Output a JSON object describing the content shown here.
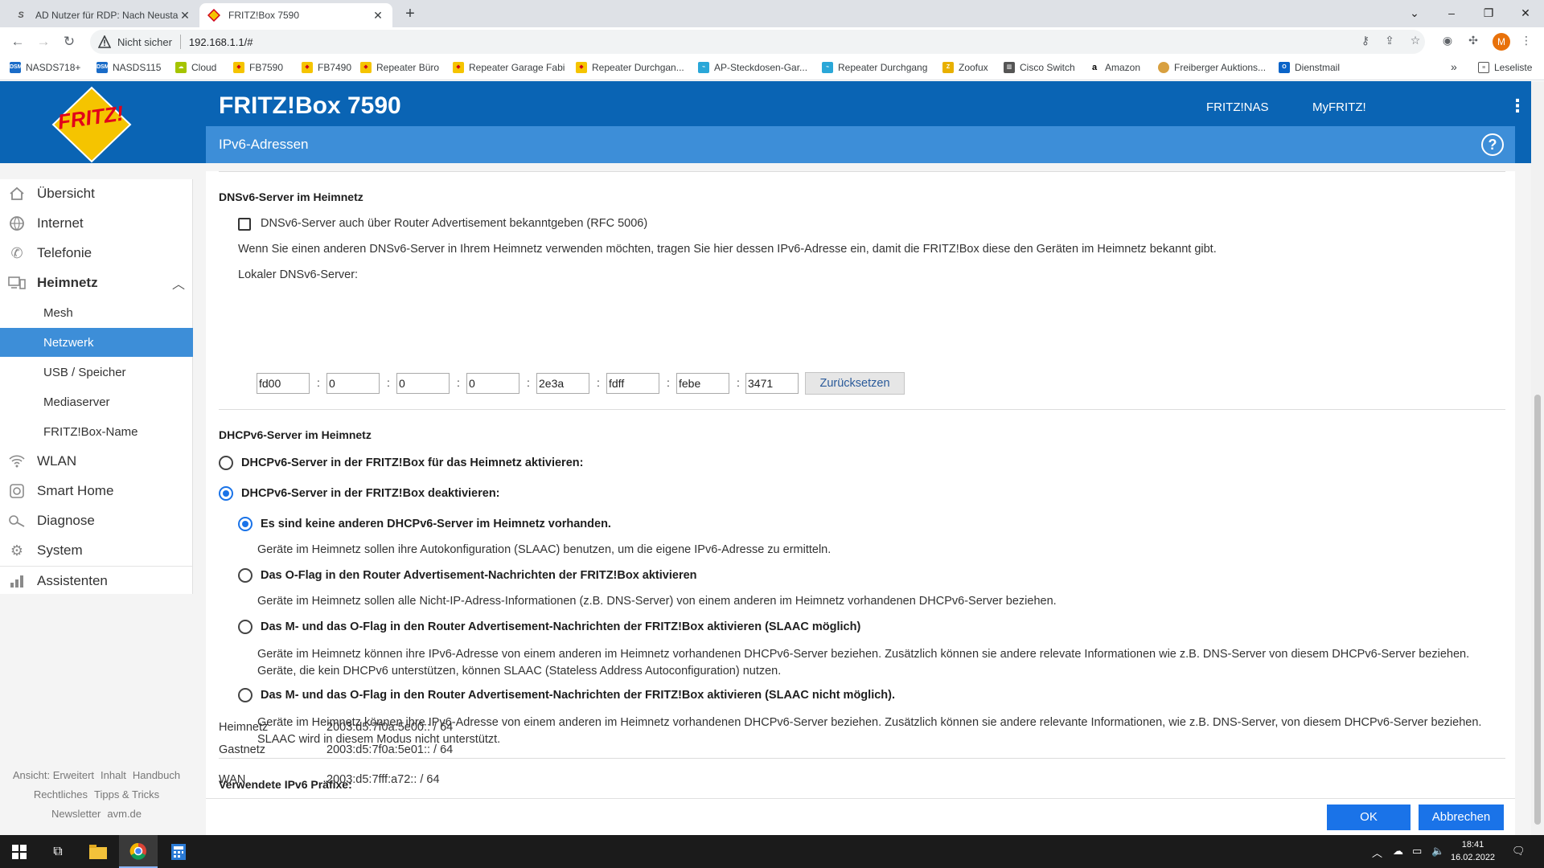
{
  "browser": {
    "tabs": [
      {
        "title": "AD Nutzer für RDP: Nach Neusta",
        "active": false
      },
      {
        "title": "FRITZ!Box 7590",
        "active": true
      }
    ],
    "not_secure_label": "Nicht sicher",
    "url": "192.168.1.1/#",
    "profile_initial": "M",
    "bookmarks": [
      {
        "label": "NASDS718+"
      },
      {
        "label": "NASDS115"
      },
      {
        "label": "Cloud"
      },
      {
        "label": "FB7590"
      },
      {
        "label": "FB7490"
      },
      {
        "label": "Repeater Büro"
      },
      {
        "label": "Repeater Garage Fabi"
      },
      {
        "label": "Repeater Durchgan..."
      },
      {
        "label": "AP-Steckdosen-Gar..."
      },
      {
        "label": "Repeater Durchgang"
      },
      {
        "label": "Zoofux"
      },
      {
        "label": "Cisco Switch"
      },
      {
        "label": "Amazon"
      },
      {
        "label": "Freiberger Auktions..."
      },
      {
        "label": "Dienstmail"
      }
    ],
    "reading_list_label": "Leseliste"
  },
  "header": {
    "logo_text": "FRITZ!",
    "product_name": "FRITZ!Box 7590",
    "links": [
      "FRITZ!NAS",
      "MyFRITZ!"
    ],
    "page_title": "IPv6-Adressen",
    "help_symbol": "?"
  },
  "sidebar": {
    "items": [
      {
        "label": "Übersicht",
        "icon": "home-icon"
      },
      {
        "label": "Internet",
        "icon": "globe-icon"
      },
      {
        "label": "Telefonie",
        "icon": "phone-icon"
      },
      {
        "label": "Heimnetz",
        "icon": "network-icon",
        "expanded": true
      },
      {
        "label": "Mesh",
        "sub": true
      },
      {
        "label": "Netzwerk",
        "sub": true,
        "active": true
      },
      {
        "label": "USB / Speicher",
        "sub": true
      },
      {
        "label": "Mediaserver",
        "sub": true
      },
      {
        "label": "FRITZ!Box-Name",
        "sub": true
      },
      {
        "label": "WLAN",
        "icon": "wifi-icon"
      },
      {
        "label": "Smart Home",
        "icon": "smarthome-icon"
      },
      {
        "label": "Diagnose",
        "icon": "diagnose-icon"
      },
      {
        "label": "System",
        "icon": "system-icon"
      },
      {
        "label": "Assistenten",
        "icon": "wizard-icon"
      }
    ],
    "footer": {
      "row1": [
        "Ansicht: Erweitert",
        "Inhalt",
        "Handbuch"
      ],
      "row2": [
        "Rechtliches",
        "Tipps & Tricks"
      ],
      "row3": [
        "Newsletter",
        "avm.de"
      ]
    }
  },
  "dnsv6": {
    "title": "DNSv6-Server im Heimnetz",
    "ra_checkbox_label": "DNSv6-Server auch über Router Advertisement bekanntgeben (RFC 5006)",
    "ra_checked": false,
    "info_text": "Wenn Sie einen anderen DNSv6-Server in Ihrem Heimnetz verwenden möchten, tragen Sie hier dessen IPv6-Adresse ein, damit die FRITZ!Box diese den Geräten im Heimnetz bekannt gibt.",
    "local_label": "Lokaler DNSv6-Server:",
    "address_fields": [
      "fd00",
      "0",
      "0",
      "0",
      "2e3a",
      "fdff",
      "febe",
      "3471"
    ],
    "separator": ":",
    "reset_label": "Zurücksetzen"
  },
  "dhcpv6": {
    "title": "DHCPv6-Server im Heimnetz",
    "activate_label": "DHCPv6-Server in der FRITZ!Box für das Heimnetz aktivieren:",
    "deactivate_label": "DHCPv6-Server in der FRITZ!Box deaktivieren:",
    "options": [
      {
        "label": "Es sind keine anderen DHCPv6-Server im Heimnetz vorhanden.",
        "description": "Geräte im Heimnetz sollen ihre Autokonfiguration (SLAAC) benutzen, um die eigene IPv6-Adresse zu ermitteln.",
        "selected": true
      },
      {
        "label": "Das O-Flag in den Router Advertisement-Nachrichten der FRITZ!Box aktivieren",
        "description": "Geräte im Heimnetz sollen alle Nicht-IP-Adress-Informationen (z.B. DNS-Server) von einem anderen im Heimnetz vorhandenen DHCPv6-Server beziehen.",
        "selected": false
      },
      {
        "label": "Das M- und das O-Flag in den Router Advertisement-Nachrichten der FRITZ!Box aktivieren (SLAAC möglich)",
        "description": "Geräte im Heimnetz können ihre IPv6-Adresse von einem anderen im Heimnetz vorhandenen DHCPv6-Server beziehen. Zusätzlich können sie andere relevate Informationen wie z.B. DNS-Server von diesem DHCPv6-Server beziehen. Geräte, die kein DHCPv6 unterstützen, können SLAAC (Stateless Address Autoconfiguration) nutzen.",
        "selected": false
      },
      {
        "label": "Das M- und das O-Flag in den Router Advertisement-Nachrichten der FRITZ!Box aktivieren (SLAAC nicht möglich).",
        "description": "Geräte im Heimnetz können ihre IPv6-Adresse von einem anderen im Heimnetz vorhandenen DHCPv6-Server beziehen. Zusätzlich können sie andere relevante Informationen, wie z.B. DNS-Server, von diesem DHCPv6-Server beziehen. SLAAC wird in diesem Modus nicht unterstützt.",
        "selected": false
      }
    ]
  },
  "prefixes": {
    "title": "Verwendete IPv6 Präfixe:",
    "rows": [
      {
        "name": "Heimnetz",
        "value": "2003:d5:7f0a:5e00:: / 64"
      },
      {
        "name": "Gastnetz",
        "value": "2003:d5:7f0a:5e01:: / 64"
      },
      {
        "name": "WAN",
        "value": "2003:d5:7fff:a72:: / 64"
      }
    ]
  },
  "buttons": {
    "ok": "OK",
    "cancel": "Abbrechen"
  },
  "taskbar": {
    "time": "18:41",
    "date": "16.02.2022"
  }
}
